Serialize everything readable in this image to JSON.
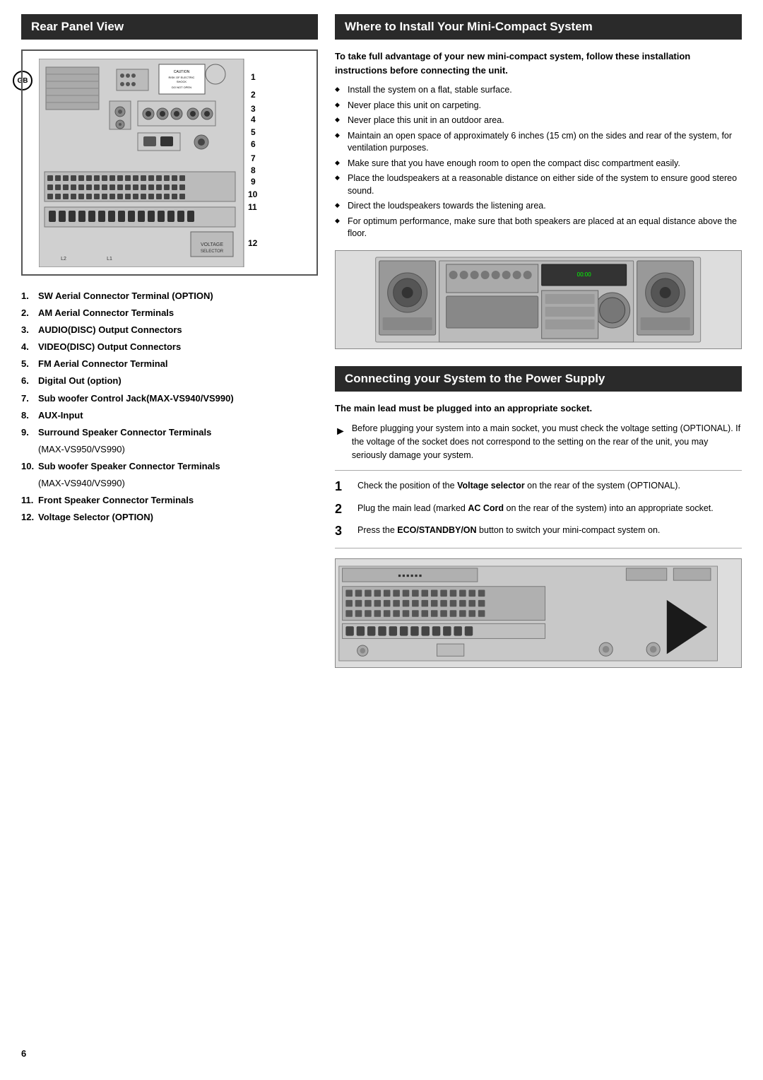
{
  "page": {
    "number": "6",
    "gb_label": "GB"
  },
  "left_section": {
    "title": "Rear Panel View",
    "panel_numbers": [
      "1",
      "2",
      "3",
      "4",
      "5",
      "6",
      "7",
      "8",
      "9",
      "10",
      "11",
      "12"
    ],
    "items": [
      {
        "num": "1.",
        "label": "SW Aerial Connector Terminal (OPTION)"
      },
      {
        "num": "2.",
        "label": "AM Aerial Connector Terminals"
      },
      {
        "num": "3.",
        "label": "AUDIO(DISC) Output Connectors"
      },
      {
        "num": "4.",
        "label": "VIDEO(DISC) Output Connectors"
      },
      {
        "num": "5.",
        "label": "FM Aerial Connector Terminal"
      },
      {
        "num": "6.",
        "label": "Digital Out (option)"
      },
      {
        "num": "7.",
        "label": "Sub woofer Control Jack(MAX-VS940/VS990)"
      },
      {
        "num": "8.",
        "label": "AUX-Input"
      },
      {
        "num": "9.",
        "label": "Surround Speaker Connector Terminals",
        "sub": "(MAX-VS950/VS990)"
      },
      {
        "num": "10.",
        "label": "Sub woofer Speaker Connector Terminals",
        "sub": "(MAX-VS940/VS990)"
      },
      {
        "num": "11.",
        "label": "Front Speaker Connector Terminals"
      },
      {
        "num": "12.",
        "label": "Voltage Selector (OPTION)"
      }
    ]
  },
  "right_section": {
    "install_title": "Where to Install Your Mini-Compact System",
    "install_intro": "To take full advantage of your new mini-compact system, follow these installation instructions before connecting the unit.",
    "install_bullets": [
      "Install the system on a flat, stable surface.",
      "Never place this unit on carpeting.",
      "Never place this unit in an outdoor area.",
      "Maintain an open space of approximately 6 inches (15 cm) on the sides and rear of the system, for ventilation purposes.",
      "Make sure that you have enough room to open the compact disc compartment easily.",
      "Place the loudspeakers at a reasonable distance on either side of the system to ensure good stereo sound.",
      "Direct the loudspeakers towards the listening area.",
      "For optimum performance, make sure that both speakers are placed at an equal distance above the floor."
    ],
    "power_title": "Connecting your System to the Power Supply",
    "power_intro": "The main lead must be plugged into an appropriate socket.",
    "power_note": "Before plugging your system into a main socket, you must check the voltage setting (OPTIONAL). If the voltage of the socket does not correspond to the setting on the rear of the unit, you may seriously damage your system.",
    "steps": [
      {
        "num": "1",
        "text": "Check the position of the ",
        "bold": "Voltage selector",
        "text2": " on the rear of the system (OPTIONAL)."
      },
      {
        "num": "2",
        "text": "Plug the main lead (marked ",
        "bold": "AC Cord",
        "text2": " on the rear of the system) into an appropriate socket."
      },
      {
        "num": "3",
        "text": "Press the ",
        "bold": "ECO/STANDBY/ON",
        "text2": " button to switch your mini-compact system on."
      }
    ]
  }
}
